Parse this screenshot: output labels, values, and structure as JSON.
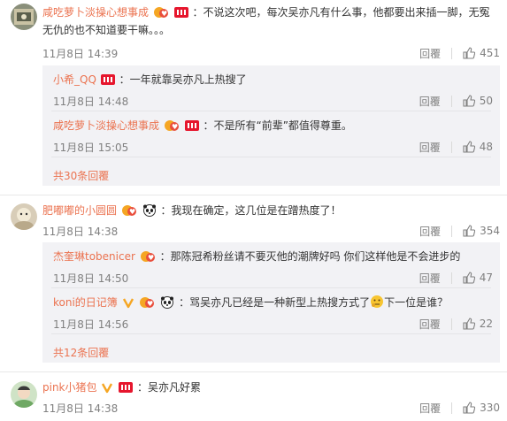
{
  "comments": [
    {
      "user": "咸吃萝卜淡操心想事成",
      "text": "：不说这次吧，每次吴亦凡有什么事，他都要出来插一脚，无冤无仇的也不知道要干嘛。。。",
      "time": "11月8日 14:39",
      "reply_label": "回覆",
      "likes": "451",
      "replies": [
        {
          "user": "小希_QQ",
          "text": "：一年就靠吴亦凡上热搜了",
          "time": "11月8日 14:48",
          "reply_label": "回覆",
          "likes": "50"
        },
        {
          "user": "咸吃萝卜淡操心想事成",
          "text": "：不是所有“前辈”都值得尊重。",
          "time": "11月8日 15:05",
          "reply_label": "回覆",
          "likes": "48"
        }
      ],
      "more": "共30条回覆"
    },
    {
      "user": "肥嘟嘟的小圆圆",
      "text": "：我现在确定，这几位是在蹭热度了！",
      "time": "11月8日 14:38",
      "reply_label": "回覆",
      "likes": "354",
      "replies": [
        {
          "user": "杰奎琳tobenicer",
          "text": "：那陈冠希粉丝请不要灭他的潮牌好吗 你们这样他是不会进步的",
          "time": "11月8日 14:50",
          "reply_label": "回覆",
          "likes": "47"
        },
        {
          "user": "koni的日记簿",
          "text_a": "：骂吴亦凡已经是一种新型上热搜方式了",
          "text_b": "下一位是谁？",
          "time": "11月8日 14:56",
          "reply_label": "回覆",
          "likes": "22"
        }
      ],
      "more": "共12条回覆"
    },
    {
      "user": "pink小猪包",
      "text": "：吴亦凡好累",
      "time": "11月8日 14:38",
      "reply_label": "回覆",
      "likes": "330"
    }
  ],
  "colors": {
    "username": "#eb7350",
    "meta": "#808080",
    "reply_bg": "#f2f2f5"
  },
  "icons": [
    "thumb-up-icon",
    "vip-badge-icon",
    "member-badge-icon",
    "panda-badge-icon",
    "thinking-emoji-icon"
  ]
}
